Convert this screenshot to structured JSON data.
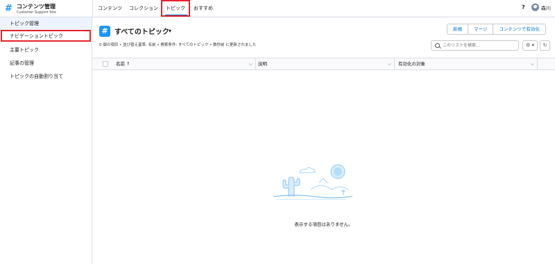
{
  "app": {
    "icon": "#",
    "title": "コンテンツ管理",
    "subtitle": "Customer Support Site"
  },
  "topnav": {
    "items": [
      "コンテンツ",
      "コレクション",
      "トピック",
      "おすすめ"
    ],
    "help": "?",
    "user": "森川"
  },
  "sidebar": {
    "items": [
      {
        "label": "トピック管理"
      },
      {
        "label": "ナビゲーショントピック"
      },
      {
        "label": "主要トピック"
      },
      {
        "label": "記事の管理"
      },
      {
        "label": "トピックの自動割り当て"
      }
    ]
  },
  "list": {
    "icon": "#",
    "title": "すべてのトピック",
    "caret": "▾",
    "meta": "0 個の項目 • 並び替え基準: 名前 • 検索条件: すべてのトピック • 数秒前 に更新されました",
    "buttons": [
      "新規",
      "マージ",
      "コンテンツで有効化"
    ],
    "search_placeholder": "このリストを検索...",
    "settings_icon": "⚙ ▾",
    "refresh_icon": "↻"
  },
  "table": {
    "columns": [
      {
        "label": "名前",
        "sort": "↑"
      },
      {
        "label": "説明"
      },
      {
        "label": "有効化の対象"
      }
    ],
    "chevron": "⌵"
  },
  "empty": {
    "message": "表示する項目はありません。"
  },
  "colors": {
    "accent": "#0176d3",
    "brand_icon": "#1b96ff",
    "highlight": "#e8202a"
  }
}
